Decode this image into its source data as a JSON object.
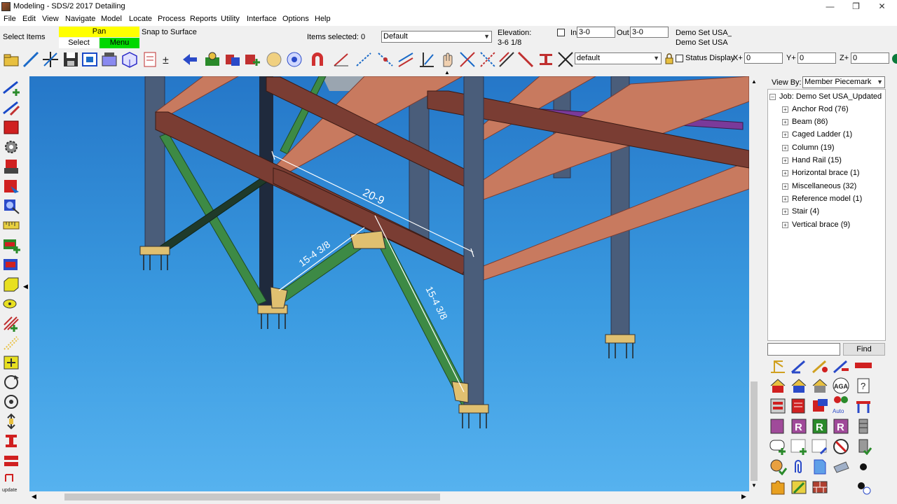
{
  "window": {
    "title": "Modeling - SDS/2 2017 Detailing"
  },
  "menu": [
    "File",
    "Edit",
    "View",
    "Navigate",
    "Model",
    "Locate",
    "Process",
    "Reports",
    "Utility",
    "Interface",
    "Options",
    "Help"
  ],
  "status": {
    "select_items": "Select Items",
    "pan": "Pan",
    "snap": "Snap to Surface",
    "select": "Select",
    "menu": "Menu",
    "items_selected": "Items selected: 0",
    "view_combo": "Default",
    "elevation_label": "Elevation:",
    "elevation_value": "3-6 1/8",
    "in_label": "In",
    "in_value": "3-0",
    "out_label": "Out",
    "out_value": "3-0",
    "set1": "Demo Set USA_Uj",
    "set2": "Demo Set USA"
  },
  "toolbar": {
    "layer_combo": "default",
    "status_display": "Status Display",
    "x_label": "X+",
    "x_value": "0",
    "y_label": "Y+",
    "y_value": "0",
    "z_label": "Z+",
    "z_value": "0"
  },
  "model": {
    "dim_top": "20-9",
    "dim_left": "15-4 3/8",
    "dim_right": "15-4 3/8"
  },
  "panel": {
    "view_by_label": "View By:",
    "view_by_value": "Member Piecemark",
    "root": "Job: Demo Set USA_Updated",
    "items": [
      "Anchor Rod (76)",
      "Beam (86)",
      "Caged Ladder (1)",
      "Column (19)",
      "Hand Rail (15)",
      "Horizontal brace (1)",
      "Miscellaneous (32)",
      "Reference model (1)",
      "Stair (4)",
      "Vertical brace (9)"
    ],
    "search_value": "",
    "find_label": "Find",
    "auto_label": "Auto"
  },
  "colors": {
    "beam": "#c87a5f",
    "beam_dark": "#7a3d33",
    "column": "#4a5d7a",
    "brace": "#3d8a45",
    "sky_top": "#2577c8",
    "sky_bottom": "#56b2ef",
    "pan_bg": "#ffff00",
    "menu_bg": "#00d800"
  }
}
